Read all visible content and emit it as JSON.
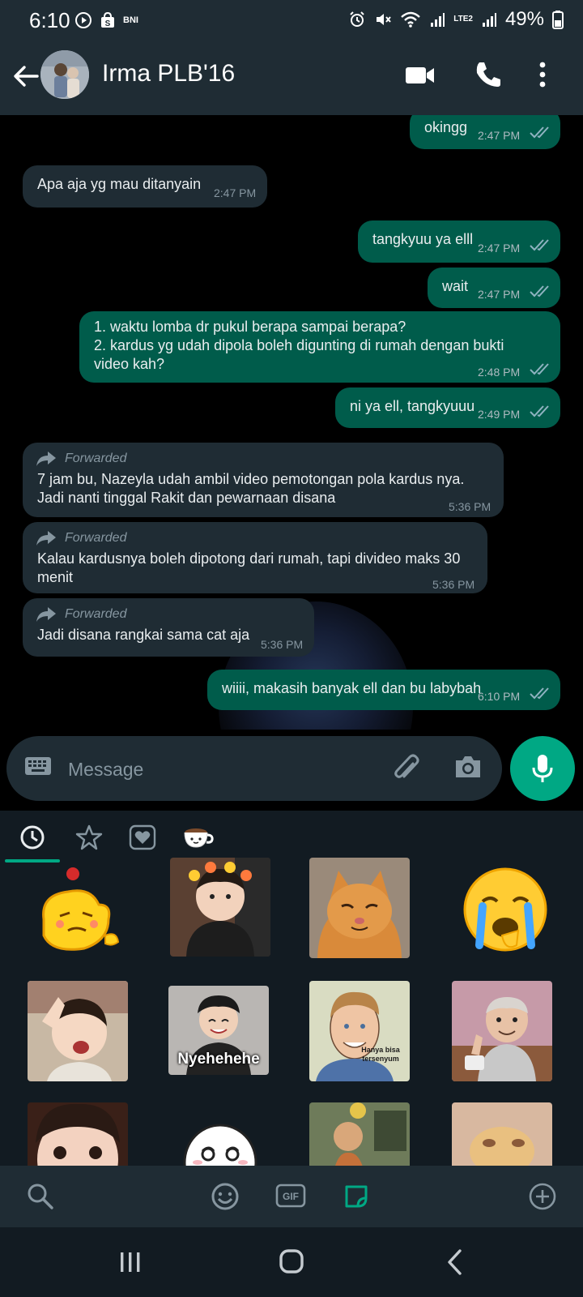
{
  "status_bar": {
    "time": "6:10",
    "bank_label": "BNI",
    "network_label": "LTE2",
    "battery": "49%"
  },
  "header": {
    "contact_name": "Irma PLB'16"
  },
  "messages": [
    {
      "text": "okingg",
      "time": "2:47 PM"
    },
    {
      "text": "Apa aja yg mau ditanyain",
      "time": "2:47 PM"
    },
    {
      "text": "tangkyuu ya elll",
      "time": "2:47 PM"
    },
    {
      "text": "wait",
      "time": "2:47 PM"
    },
    {
      "text": "1. waktu lomba dr pukul berapa sampai berapa?\n2. kardus yg udah dipola boleh digunting di rumah dengan bukti video kah?",
      "time": "2:48 PM"
    },
    {
      "text": "ni ya ell, tangkyuuu",
      "time": "2:49 PM"
    },
    {
      "forwarded_label": "Forwarded",
      "text": "7 jam bu, Nazeyla udah ambil video pemotongan pola kardus nya. Jadi nanti tinggal Rakit dan pewarnaan disana",
      "time": "5:36 PM"
    },
    {
      "forwarded_label": "Forwarded",
      "text": "Kalau kardusnya boleh dipotong dari rumah, tapi divideo maks 30 menit",
      "time": "5:36 PM"
    },
    {
      "forwarded_label": "Forwarded",
      "text": "Jadi disana rangkai sama cat aja",
      "time": "5:36 PM"
    },
    {
      "text": "wiiii, makasih banyak ell dan bu labybah",
      "time": "6:10 PM"
    }
  ],
  "composer": {
    "placeholder": "Message"
  },
  "stickers": {
    "tabs": [
      "recent-icon",
      "star-icon",
      "heart-icon",
      "coffee-cup-icon"
    ],
    "captions": [
      "Nyehehehe",
      "Hanya bisa tersenyum"
    ]
  },
  "colors": {
    "header_bg": "#1f2c34",
    "outgoing_bubble": "#005c4b",
    "incoming_bubble": "#1f2c34",
    "accent": "#00a884",
    "read_ticks": "#8fb3c1"
  }
}
